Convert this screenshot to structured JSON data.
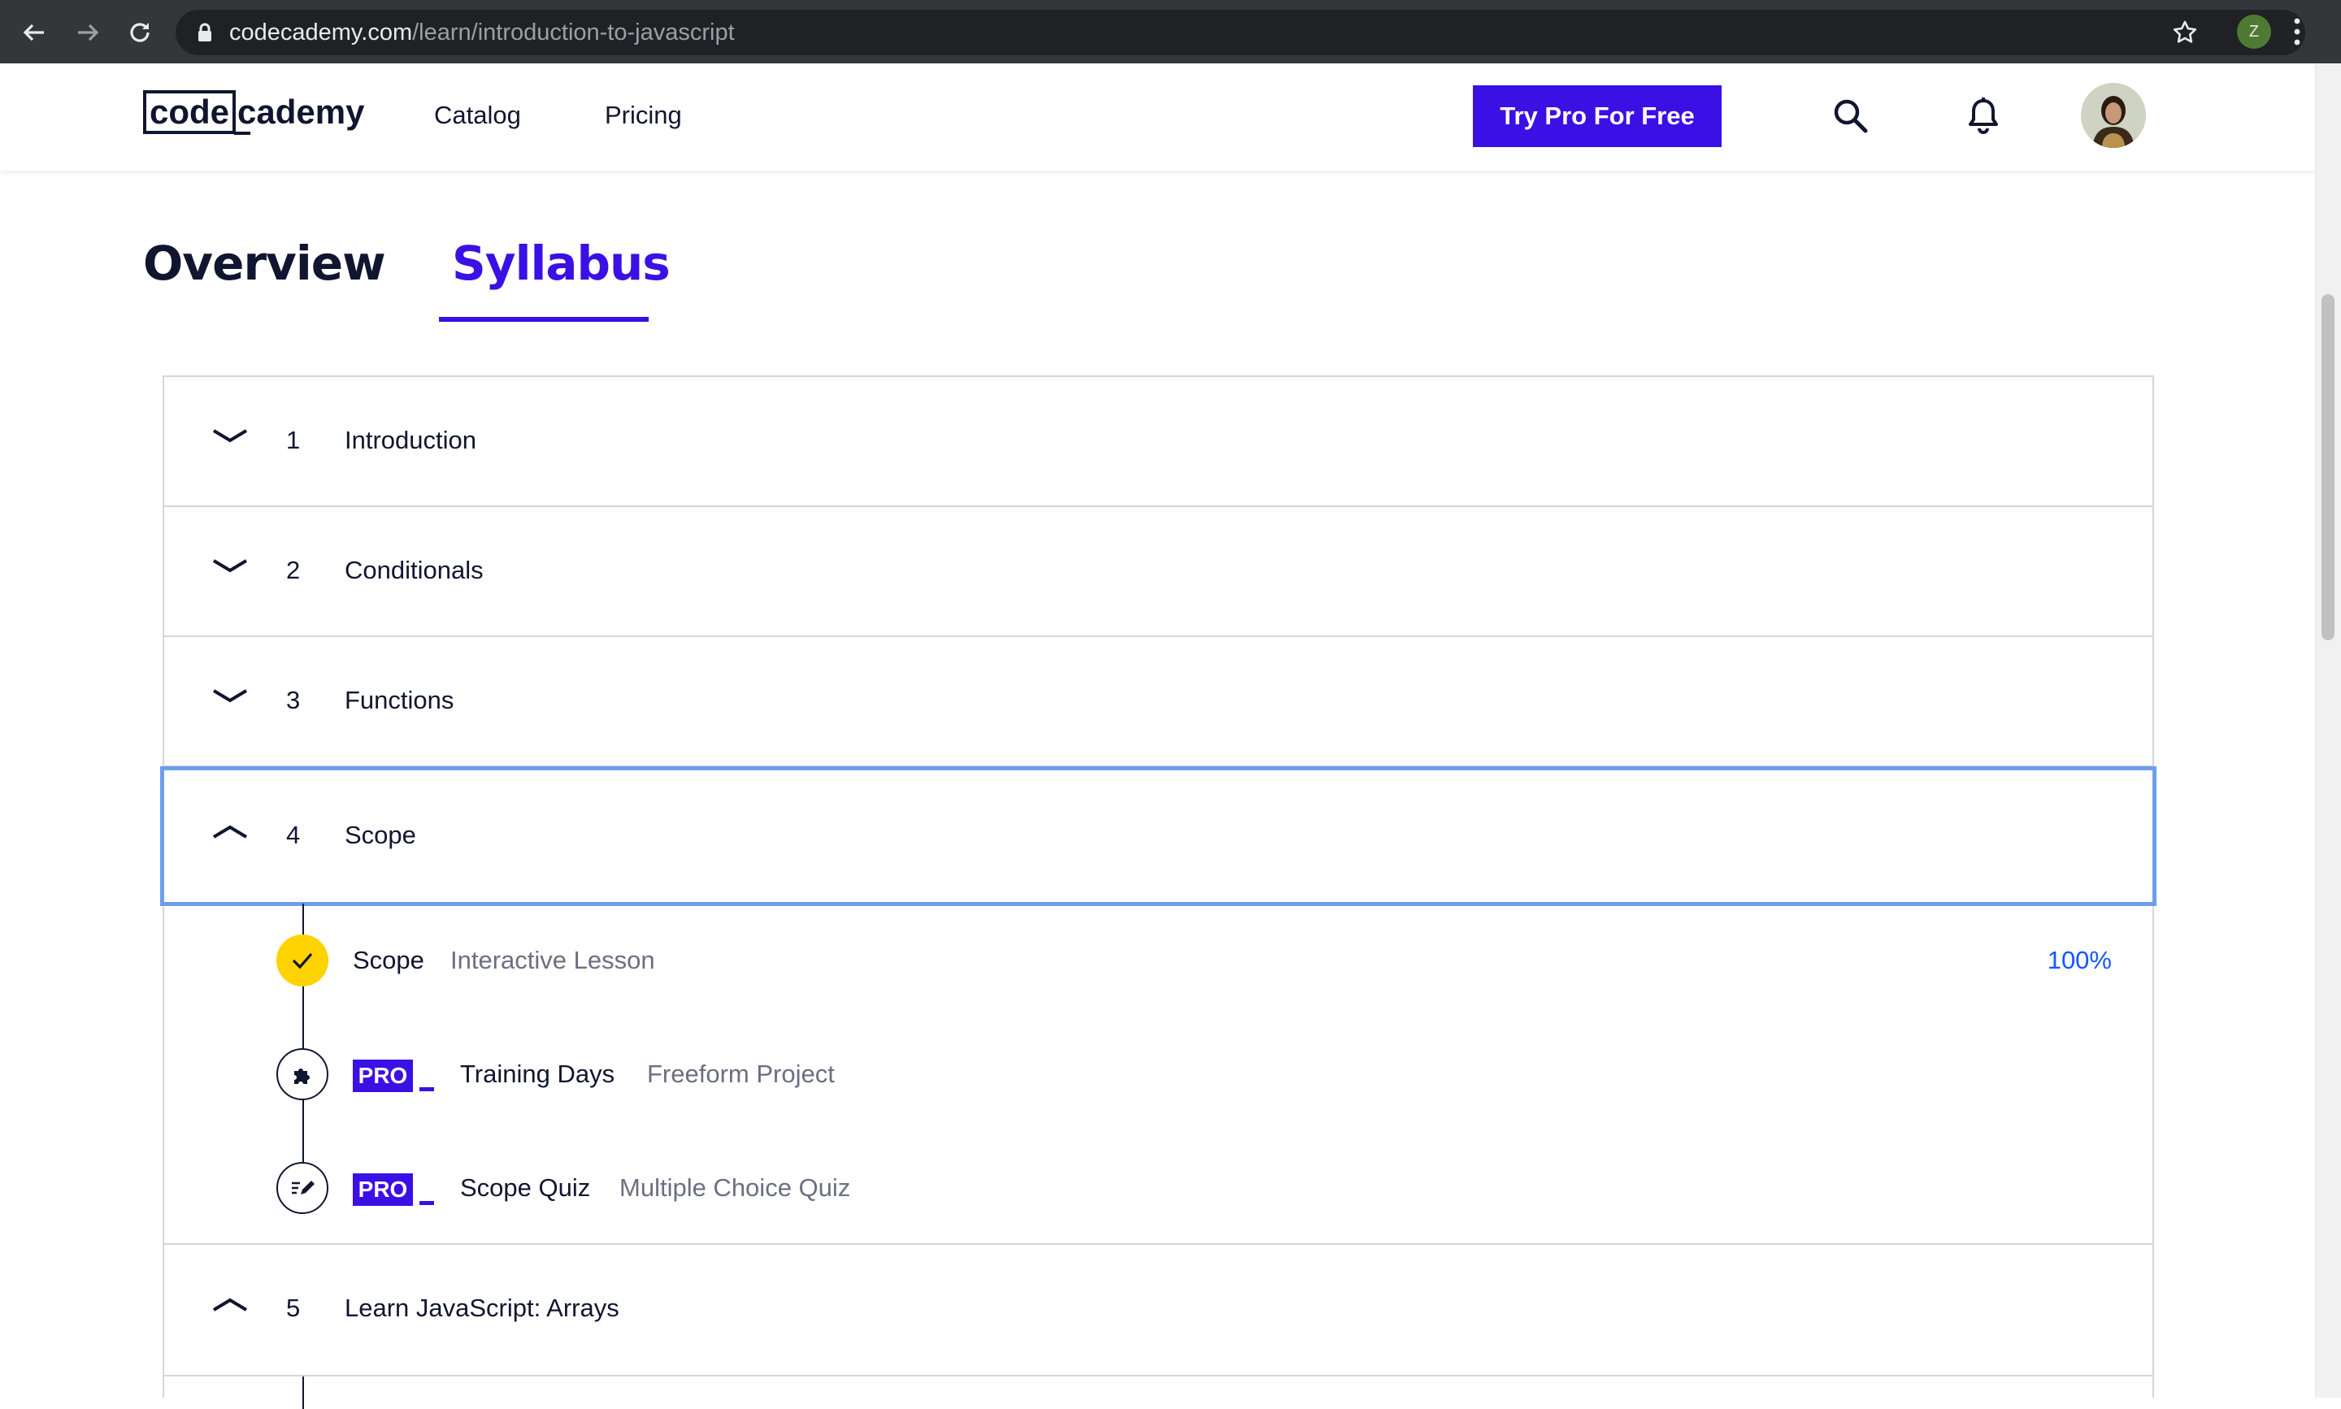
{
  "browser": {
    "url_host": "codecademy.com",
    "url_path": "/learn/introduction-to-javascript",
    "profile_initial": "Z"
  },
  "header": {
    "logo_part1": "code",
    "logo_part2": "cademy",
    "nav": [
      "Catalog",
      "Pricing"
    ],
    "cta_label": "Try Pro For Free"
  },
  "tabs": {
    "overview": "Overview",
    "syllabus": "Syllabus",
    "active": "Syllabus"
  },
  "modules": [
    {
      "num": "1",
      "title": "Introduction",
      "expanded": false
    },
    {
      "num": "2",
      "title": "Conditionals",
      "expanded": false
    },
    {
      "num": "3",
      "title": "Functions",
      "expanded": false
    },
    {
      "num": "4",
      "title": "Scope",
      "expanded": true
    },
    {
      "num": "5",
      "title": "Learn JavaScript: Arrays",
      "expanded": true
    }
  ],
  "scope_lessons": [
    {
      "name": "Scope",
      "kind": "Interactive Lesson",
      "progress": "100%",
      "status": "complete",
      "icon": "check-icon"
    },
    {
      "name": "Training Days",
      "kind": "Freeform Project",
      "pro": "PRO",
      "status": "locked",
      "icon": "puzzle-icon"
    },
    {
      "name": "Scope Quiz",
      "kind": "Multiple Choice Quiz",
      "pro": "PRO",
      "status": "locked",
      "icon": "quiz-pencil-icon"
    }
  ],
  "colors": {
    "brand_purple": "#3a10e5",
    "complete_yellow": "#ffd300",
    "progress_blue": "#1557ff",
    "focus_ring": "#6d9eeb"
  }
}
